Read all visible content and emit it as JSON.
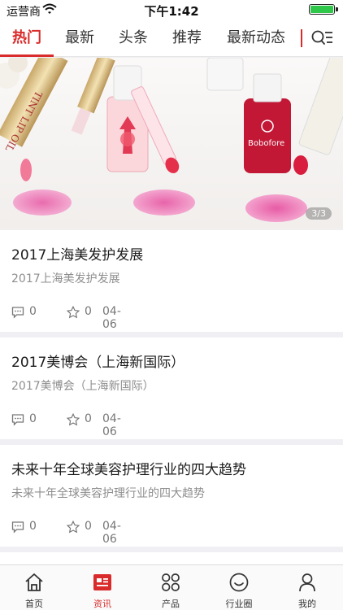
{
  "status": {
    "carrier": "运营商",
    "time": "下午1:42"
  },
  "tabs": [
    {
      "label": "热门",
      "active": true
    },
    {
      "label": "最新",
      "active": false
    },
    {
      "label": "头条",
      "active": false
    },
    {
      "label": "推荐",
      "active": false
    },
    {
      "label": "最新动态",
      "active": false
    }
  ],
  "banner": {
    "pager": "3/3",
    "brand_text": "Bobofore"
  },
  "articles": [
    {
      "title": "2017上海美发护发展",
      "summary": "2017上海美发护发展",
      "comments": "0",
      "likes": "0",
      "date": "04-06"
    },
    {
      "title": "2017美博会（上海新国际）",
      "summary": "2017美博会（上海新国际）",
      "comments": "0",
      "likes": "0",
      "date": "04-06"
    },
    {
      "title": "未来十年全球美容护理行业的四大趋势",
      "summary": "未来十年全球美容护理行业的四大趋势",
      "comments": "0",
      "likes": "0",
      "date": "04-06"
    }
  ],
  "nav": [
    {
      "label": "首页",
      "icon": "home-icon",
      "active": false
    },
    {
      "label": "资讯",
      "icon": "news-icon",
      "active": true
    },
    {
      "label": "产品",
      "icon": "products-icon",
      "active": false
    },
    {
      "label": "行业圈",
      "icon": "circle-icon",
      "active": false
    },
    {
      "label": "我的",
      "icon": "profile-icon",
      "active": false
    }
  ],
  "colors": {
    "accent": "#d92b2b",
    "battery": "#2ec74a"
  }
}
